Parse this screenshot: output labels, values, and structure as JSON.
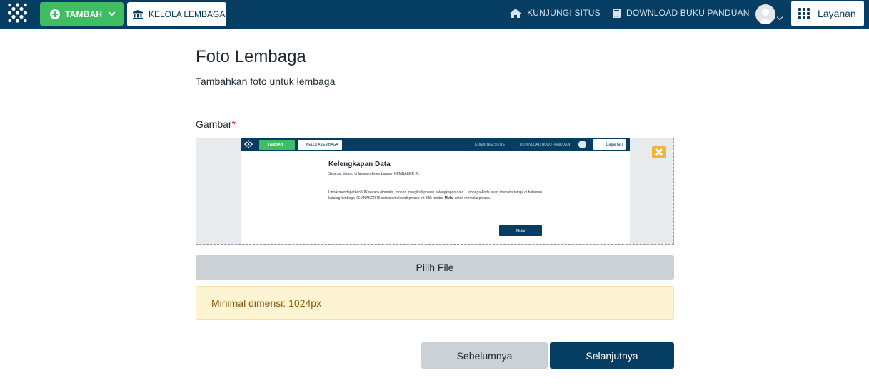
{
  "navbar": {
    "tambah_label": "TAMBAH",
    "kelola_label": "KELOLA LEMBAGA",
    "kunjungi_label": "KUNJUNGI SITUS",
    "download_label": "DOWNLOAD BUKU PANDUAN",
    "layanan_label": "Layanan"
  },
  "page": {
    "title": "Foto Lembaga",
    "subtitle": "Tambahkan foto untuk lembaga"
  },
  "form": {
    "image_label": "Gambar",
    "required_mark": "*",
    "choose_file_label": "Pilih File",
    "min_dimension_alert": "Minimal dimensi: 1024px"
  },
  "preview": {
    "tambah_label": "TAMBAH",
    "kelola_label": "KELOLA LEMBAGA",
    "kunjungi_label": "KUNJUNGI SITUS",
    "download_label": "DOWNLOAD BUKU PANDUAN",
    "layanan_label": "Layanan",
    "title": "Kelengkapan Data",
    "welcome": "Selamat datang di layanan kelembagaan KEMNAKER RI.",
    "body_text_before": "Untuk mendapatkan VIN secara otomatis, mohon mengikuti proses kelengkapan data. Lembaga Anda akan otomatis tampil di halaman katalog lembaga KEMNAKER RI setelah melewati proses ini. Klik tombol ",
    "body_text_bold": "Mulai",
    "body_text_after": " untuk memulai proses.",
    "button_label": "Mulai"
  },
  "footer_buttons": {
    "prev_label": "Sebelumnya",
    "next_label": "Selanjutnya"
  },
  "colors": {
    "navbar": "#063d63",
    "tambah_green": "#3ebd62",
    "alert_bg": "#fdf4d3",
    "remove_orange": "#f2b23b",
    "primary": "#063d63"
  },
  "icons": {
    "logo": "kemnaker-logo-icon",
    "plus": "plus-circle-icon",
    "building": "building-icon",
    "home": "home-icon",
    "book": "book-icon",
    "grid": "grid-icon",
    "close": "close-icon"
  }
}
